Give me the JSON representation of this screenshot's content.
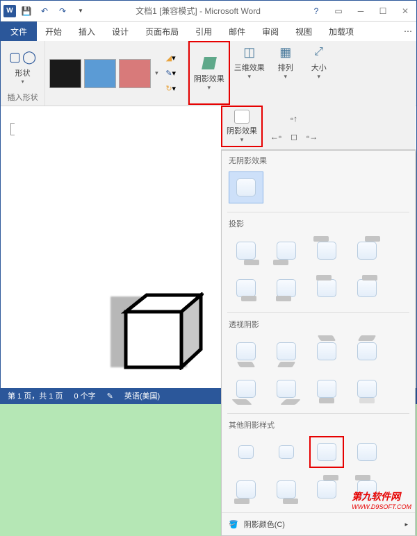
{
  "title": "文档1 [兼容模式] - Microsoft Word",
  "tabs": {
    "file": "文件",
    "home": "开始",
    "insert": "插入",
    "design": "设计",
    "layout": "页面布局",
    "references": "引用",
    "mailings": "邮件",
    "review": "审阅",
    "view": "视图",
    "addins": "加载项"
  },
  "ribbon": {
    "shapes_label": "形状",
    "insert_shapes_group": "插入形状",
    "shadow_effect": "阴影效果",
    "threeD_effect": "三维效果",
    "arrange": "排列",
    "size": "大小",
    "colors": {
      "black": "#1a1a1a",
      "blue": "#5b9bd5",
      "red": "#d87a7a"
    }
  },
  "sub_ribbon": {
    "shadow_effect": "阴影效果"
  },
  "panel": {
    "no_shadow": "无阴影效果",
    "projection": "投影",
    "perspective": "透视阴影",
    "other_styles": "其他阴影样式",
    "shadow_color": "阴影颜色(C)"
  },
  "statusbar": {
    "page": "第 1 页，共 1 页",
    "words": "0 个字",
    "language": "英语(美国)",
    "zoom": "%"
  },
  "watermark": {
    "big": "第九软件网",
    "small": "WWW.D9SOFT.COM"
  }
}
